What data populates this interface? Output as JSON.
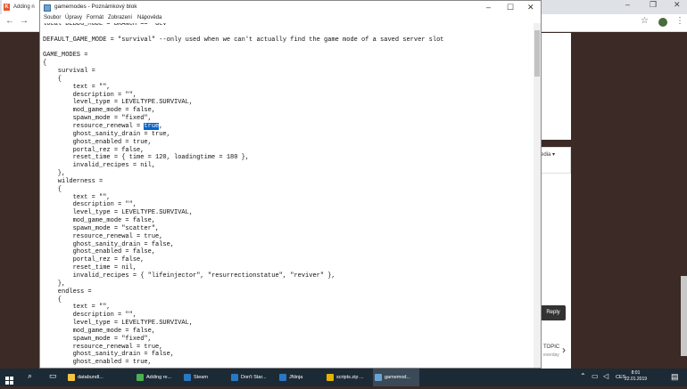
{
  "browser": {
    "tab_title": "Adding n",
    "right_page": {
      "media_label": "edia ▾",
      "reply_label": "Reply",
      "topic_label": "TOPIC",
      "topic_sub": "everday"
    }
  },
  "notepad": {
    "title": "gamemodes - Poznámkový blok",
    "menu": [
      "Soubor",
      "Úpravy",
      "Formát",
      "Zobrazení",
      "Nápověda"
    ],
    "lines_before_sel": "local DEBUG_MODE = BRANCH == \"dev\"\n\nDEFAULT_GAME_MODE = \"survival\" --only used when we can't actually find the game mode of a saved server slot\n\nGAME_MODES =\n{\n    survival =\n    {\n        text = \"\",\n        description = \"\",\n        level_type = LEVELTYPE.SURVIVAL,\n        mod_game_mode = false,\n        spawn_mode = \"fixed\",\n        resource_renewal = ",
    "selected_text": "true",
    "lines_after_sel": ",\n        ghost_sanity_drain = true,\n        ghost_enabled = true,\n        portal_rez = false,\n        reset_time = { time = 120, loadingtime = 180 },\n        invalid_recipes = nil,\n    },\n    wilderness =\n    {\n        text = \"\",\n        description = \"\",\n        level_type = LEVELTYPE.SURVIVAL,\n        mod_game_mode = false,\n        spawn_mode = \"scatter\",\n        resource_renewal = true,\n        ghost_sanity_drain = false,\n        ghost_enabled = false,\n        portal_rez = false,\n        reset_time = nil,\n        invalid_recipes = { \"lifeinjector\", \"resurrectionstatue\", \"reviver\" },\n    },\n    endless =\n    {\n        text = \"\",\n        description = \"\",\n        level_type = LEVELTYPE.SURVIVAL,\n        mod_game_mode = false,\n        spawn_mode = \"fixed\",\n        resource_renewal = true,\n        ghost_sanity_drain = false,\n        ghost_enabled = true,"
  },
  "taskbar": {
    "items": [
      {
        "label": "databundl...",
        "color": "#f4c542"
      },
      {
        "label": "Adding re...",
        "color": "#4caf50"
      },
      {
        "label": "Steam",
        "color": "#2a78c2"
      },
      {
        "label": "Don't Star...",
        "color": "#2a78c2"
      },
      {
        "label": "JNinja",
        "color": "#2a78c2"
      },
      {
        "label": "scripts.zip ...",
        "color": "#e5b400"
      },
      {
        "label": "gamemod...",
        "color": "#6ba3d6"
      }
    ],
    "lang": "CES",
    "time": "8:01",
    "date": "22.01.2019"
  }
}
